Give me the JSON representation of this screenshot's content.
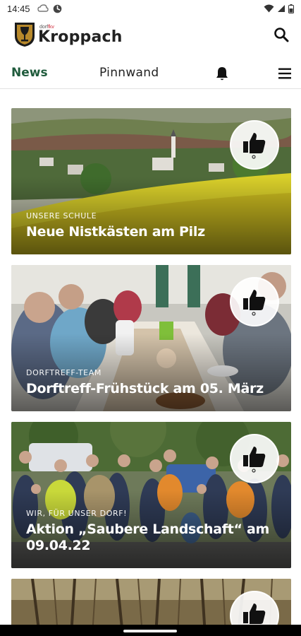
{
  "status_bar": {
    "time": "14:45"
  },
  "header": {
    "logo_small_prefix": "dorf",
    "logo_small_suffix": "fkv",
    "logo_name": "Kroppach"
  },
  "tabs": [
    {
      "label": "News",
      "active": true
    },
    {
      "label": "Pinnwand",
      "active": false
    }
  ],
  "icons": {
    "search": "search-icon",
    "bell": "bell-icon",
    "menu": "hamburger-menu-icon",
    "like": "thumbs-up-icon"
  },
  "colors": {
    "accent": "#1f5b3c",
    "text": "#1d1d1d",
    "divider": "#e2e2e2"
  },
  "feed": [
    {
      "category": "UNSERE SCHULE",
      "title": "Neue Nistkästen am Pilz"
    },
    {
      "category": "DORFTREFF-TEAM",
      "title": "Dorftreff-Frühstück am 05. März"
    },
    {
      "category": "WIR, FÜR UNSER DORF!",
      "title": "Aktion „Saubere Landschaft“ am 09.04.22"
    },
    {
      "category": "",
      "title": ""
    }
  ]
}
